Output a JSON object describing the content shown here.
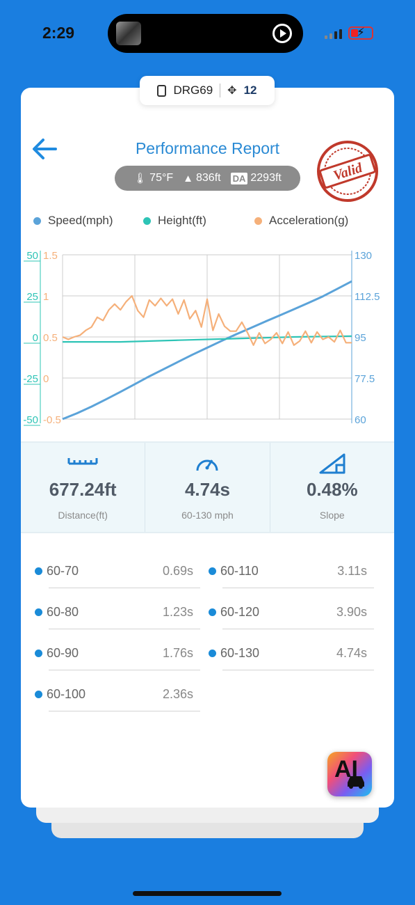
{
  "status_bar": {
    "time": "2:29"
  },
  "device": {
    "name": "DRG69",
    "satellites": "12"
  },
  "header": {
    "title": "Performance Report",
    "stamp_text": "Valid"
  },
  "conditions": {
    "temperature": "75°F",
    "altitude": "836ft",
    "da_label": "DA",
    "density_altitude": "2293ft"
  },
  "legend": [
    {
      "label": "Speed(mph)",
      "color": "#5ba3d9"
    },
    {
      "label": "Height(ft)",
      "color": "#2ec4b6"
    },
    {
      "label": "Acceleration(g)",
      "color": "#f5b07a"
    }
  ],
  "chart_data": {
    "type": "line",
    "axes": {
      "height_ticks": [
        "50",
        "25",
        "0",
        "-25",
        "-50"
      ],
      "accel_ticks": [
        "1.5",
        "1",
        "0.5",
        "0",
        "-0.5"
      ],
      "speed_ticks": [
        "130",
        "112.5",
        "95",
        "77.5",
        "60"
      ]
    },
    "ranges": {
      "height": [
        -50,
        50
      ],
      "accel": [
        -0.5,
        1.5
      ],
      "speed": [
        60,
        130
      ],
      "x": [
        0,
        1
      ]
    },
    "grid": true,
    "series": [
      {
        "name": "Speed(mph)",
        "axis": "speed",
        "color": "#5ba3d9",
        "points": [
          [
            0,
            60
          ],
          [
            0.05,
            62.5
          ],
          [
            0.1,
            65.3
          ],
          [
            0.15,
            68.4
          ],
          [
            0.2,
            71.6
          ],
          [
            0.25,
            74.9
          ],
          [
            0.3,
            78.2
          ],
          [
            0.35,
            81.3
          ],
          [
            0.4,
            84.4
          ],
          [
            0.45,
            87.5
          ],
          [
            0.5,
            90.4
          ],
          [
            0.55,
            93.3
          ],
          [
            0.6,
            96.1
          ],
          [
            0.65,
            98.8
          ],
          [
            0.7,
            101.5
          ],
          [
            0.75,
            104.1
          ],
          [
            0.8,
            106.8
          ],
          [
            0.85,
            109.5
          ],
          [
            0.9,
            112.3
          ],
          [
            0.95,
            115.5
          ],
          [
            1,
            118.7
          ]
        ]
      },
      {
        "name": "Height(ft)",
        "axis": "height",
        "color": "#2ec4b6",
        "points": [
          [
            0,
            -3
          ],
          [
            0.2,
            -3
          ],
          [
            0.4,
            -2
          ],
          [
            0.6,
            -1
          ],
          [
            0.8,
            0
          ],
          [
            1,
            0.5
          ]
        ]
      },
      {
        "name": "Acceleration(g)",
        "axis": "accel",
        "color": "#f5b07a",
        "points": [
          [
            0,
            0.5
          ],
          [
            0.02,
            0.47
          ],
          [
            0.04,
            0.5
          ],
          [
            0.06,
            0.52
          ],
          [
            0.08,
            0.58
          ],
          [
            0.1,
            0.62
          ],
          [
            0.12,
            0.74
          ],
          [
            0.14,
            0.7
          ],
          [
            0.16,
            0.83
          ],
          [
            0.18,
            0.9
          ],
          [
            0.2,
            0.83
          ],
          [
            0.22,
            0.93
          ],
          [
            0.24,
            1.0
          ],
          [
            0.26,
            0.82
          ],
          [
            0.28,
            0.74
          ],
          [
            0.3,
            0.95
          ],
          [
            0.32,
            0.88
          ],
          [
            0.34,
            0.97
          ],
          [
            0.36,
            0.88
          ],
          [
            0.38,
            0.96
          ],
          [
            0.4,
            0.78
          ],
          [
            0.42,
            0.95
          ],
          [
            0.44,
            0.72
          ],
          [
            0.46,
            0.82
          ],
          [
            0.48,
            0.62
          ],
          [
            0.5,
            0.96
          ],
          [
            0.52,
            0.58
          ],
          [
            0.54,
            0.78
          ],
          [
            0.56,
            0.63
          ],
          [
            0.58,
            0.57
          ],
          [
            0.6,
            0.57
          ],
          [
            0.62,
            0.68
          ],
          [
            0.64,
            0.55
          ],
          [
            0.66,
            0.4
          ],
          [
            0.68,
            0.55
          ],
          [
            0.7,
            0.42
          ],
          [
            0.72,
            0.47
          ],
          [
            0.74,
            0.55
          ],
          [
            0.76,
            0.42
          ],
          [
            0.78,
            0.56
          ],
          [
            0.8,
            0.4
          ],
          [
            0.82,
            0.45
          ],
          [
            0.84,
            0.57
          ],
          [
            0.86,
            0.43
          ],
          [
            0.88,
            0.56
          ],
          [
            0.9,
            0.47
          ],
          [
            0.92,
            0.5
          ],
          [
            0.94,
            0.44
          ],
          [
            0.96,
            0.58
          ],
          [
            0.98,
            0.43
          ],
          [
            1,
            0.43
          ]
        ]
      }
    ]
  },
  "stats": [
    {
      "value": "677.24ft",
      "label": "Distance(ft)",
      "icon": "ruler-icon"
    },
    {
      "value": "4.74s",
      "label": "60-130 mph",
      "icon": "speedometer-icon"
    },
    {
      "value": "0.48%",
      "label": "Slope",
      "icon": "slope-icon"
    }
  ],
  "splits": [
    {
      "name": "60-70",
      "value": "0.69s"
    },
    {
      "name": "60-80",
      "value": "1.23s"
    },
    {
      "name": "60-90",
      "value": "1.76s"
    },
    {
      "name": "60-100",
      "value": "2.36s"
    },
    {
      "name": "60-110",
      "value": "3.11s"
    },
    {
      "name": "60-120",
      "value": "3.90s"
    },
    {
      "name": "60-130",
      "value": "4.74s"
    }
  ],
  "ai_button": {
    "label": "AI"
  }
}
